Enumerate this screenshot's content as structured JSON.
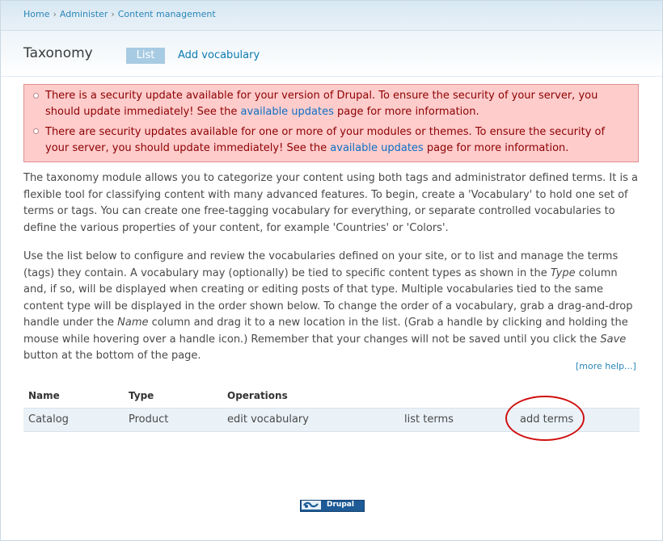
{
  "breadcrumb": {
    "items": [
      "Home",
      "Administer",
      "Content management"
    ],
    "separator": "›"
  },
  "page": {
    "title": "Taxonomy",
    "tabs": [
      {
        "label": "List",
        "active": true
      },
      {
        "label": "Add vocabulary",
        "active": false
      }
    ]
  },
  "messages": [
    {
      "before": "There is a security update available for your version of Drupal. To ensure the security of your server, you should update immediately! See the ",
      "link": "available updates",
      "after": " page for more information."
    },
    {
      "before": "There are security updates available for one or more of your modules or themes. To ensure the security of your server, you should update immediately! See the ",
      "link": "available updates",
      "after": " page for more information."
    }
  ],
  "help": {
    "p1": "The taxonomy module allows you to categorize your content using both tags and administrator defined terms. It is a flexible tool for classifying content with many advanced features. To begin, create a 'Vocabulary' to hold one set of terms or tags. You can create one free-tagging vocabulary for everything, or separate controlled vocabularies to define the various properties of your content, for example 'Countries' or 'Colors'.",
    "p2_a": "Use the list below to configure and review the vocabularies defined on your site, or to list and manage the terms (tags) they contain. A vocabulary may (optionally) be tied to specific content types as shown in the ",
    "p2_em1": "Type",
    "p2_b": " column and, if so, will be displayed when creating or editing posts of that type. Multiple vocabularies tied to the same content type will be displayed in the order shown below. To change the order of a vocabulary, grab a drag-and-drop handle under the ",
    "p2_em2": "Name",
    "p2_c": " column and drag it to a new location in the list. (Grab a handle by clicking and holding the mouse while hovering over a handle icon.) Remember that your changes will not be saved until you click the ",
    "p2_em3": "Save",
    "p2_d": " button at the bottom of the page.",
    "more_help": "[more help...]"
  },
  "table": {
    "headers": {
      "name": "Name",
      "type": "Type",
      "operations": "Operations"
    },
    "rows": [
      {
        "name": "Catalog",
        "type": "Product",
        "edit": "edit vocabulary",
        "list": "list terms",
        "add": "add terms"
      }
    ]
  },
  "footer": {
    "badge_text": "Drupal"
  },
  "colors": {
    "link": "#0b7bb1",
    "error_bg": "#ffcccc",
    "error_text": "#8c0000",
    "annotation": "#d01010"
  }
}
